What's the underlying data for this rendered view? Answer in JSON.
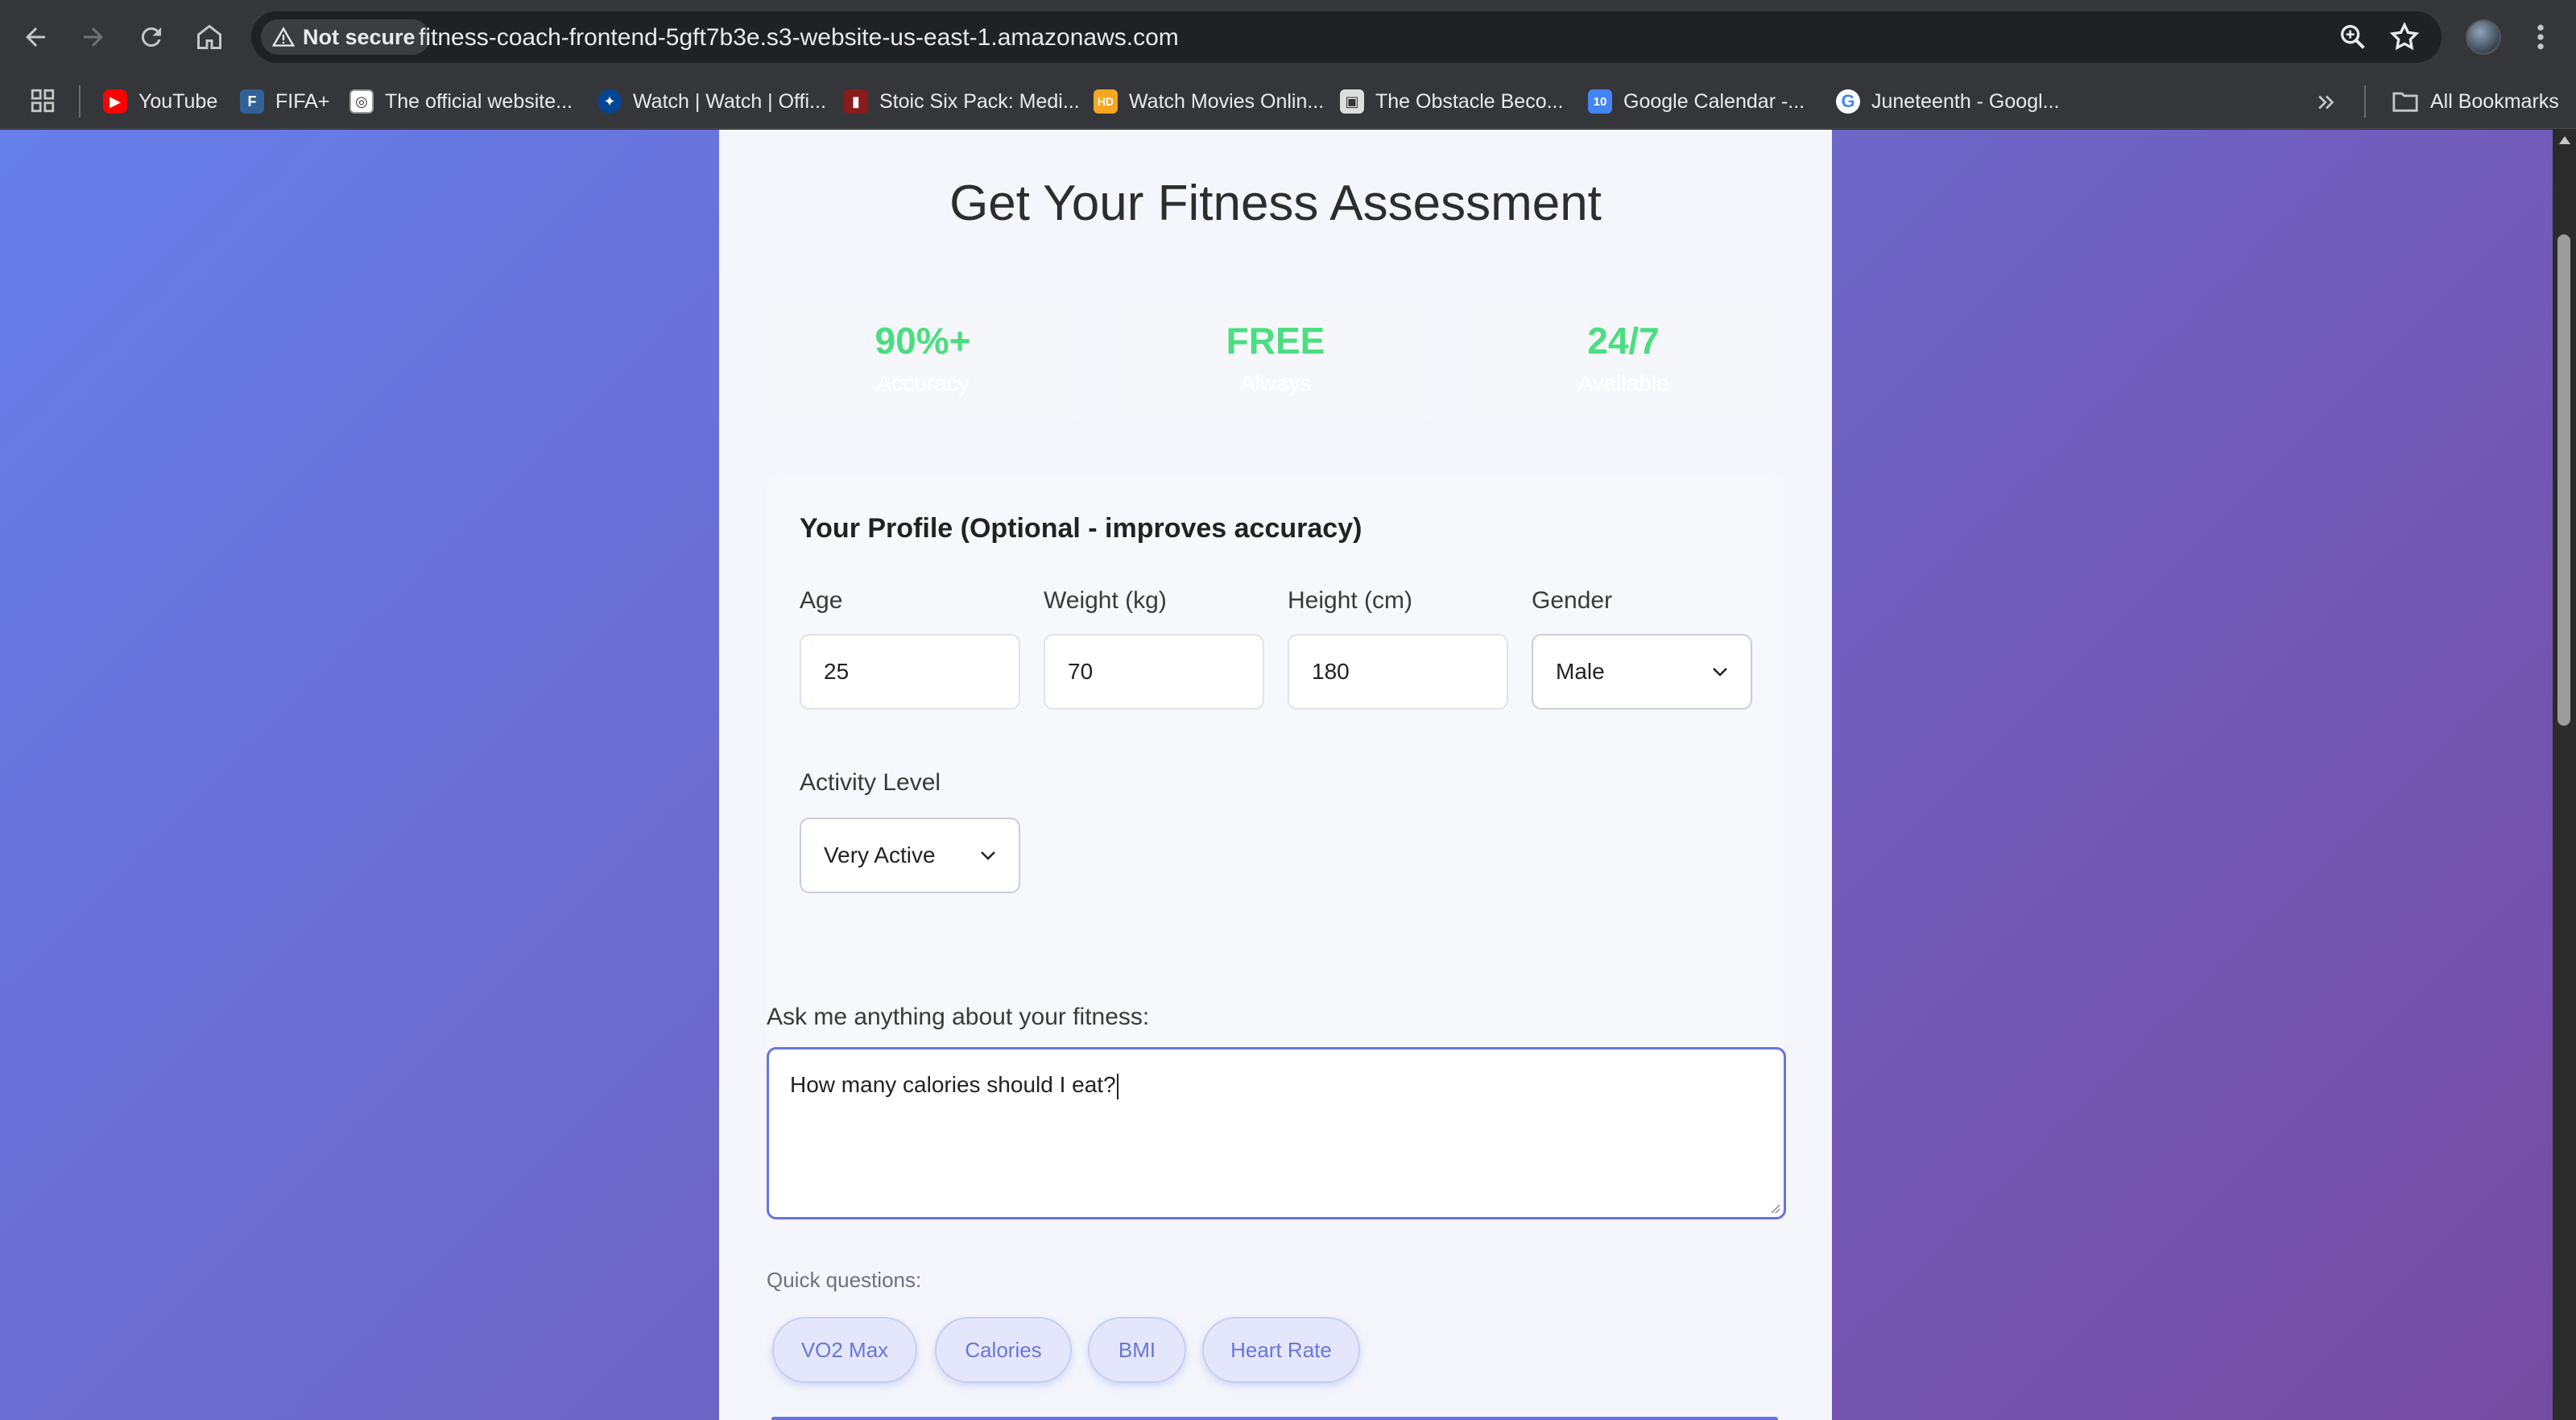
{
  "browser": {
    "security_label": "Not secure",
    "url": "fitness-coach-frontend-5gft7b3e.s3-website-us-east-1.amazonaws.com",
    "bookmarks": [
      {
        "label": "YouTube",
        "icon": "youtube-icon",
        "color": "#ff0000"
      },
      {
        "label": "FIFA+",
        "icon": "fifa-icon",
        "color": "#326295"
      },
      {
        "label": "The official website...",
        "icon": "site-icon",
        "color": "#ffffff"
      },
      {
        "label": "Watch | Watch | Offi...",
        "icon": "chelsea-icon",
        "color": "#034694"
      },
      {
        "label": "Stoic Six Pack: Medi...",
        "icon": "book-icon",
        "color": "#8b1a1a"
      },
      {
        "label": "Watch Movies Onlin...",
        "icon": "hd-icon",
        "color": "#f5a623"
      },
      {
        "label": "The Obstacle Beco...",
        "icon": "book-cover-icon",
        "color": "#dddddd"
      },
      {
        "label": "Google Calendar -...",
        "icon": "calendar-icon",
        "color": "#4285f4"
      },
      {
        "label": "Juneteenth - Googl...",
        "icon": "google-icon",
        "color": "#ffffff"
      }
    ],
    "all_bookmarks_label": "All Bookmarks"
  },
  "page": {
    "title": "Get Your Fitness Assessment",
    "stats": [
      {
        "value": "90%+",
        "label": "Accuracy"
      },
      {
        "value": "FREE",
        "label": "Always"
      },
      {
        "value": "24/7",
        "label": "Available"
      }
    ],
    "profile": {
      "title": "Your Profile (Optional - improves accuracy)",
      "age_label": "Age",
      "age_value": "25",
      "weight_label": "Weight (kg)",
      "weight_value": "70",
      "height_label": "Height (cm)",
      "height_value": "180",
      "gender_label": "Gender",
      "gender_value": "Male",
      "activity_label": "Activity Level",
      "activity_value": "Very Active"
    },
    "ask_label": "Ask me anything about your fitness:",
    "question_text": "How many calories should I eat?",
    "quick_label": "Quick questions:",
    "quick_questions": [
      "VO2 Max",
      "Calories",
      "BMI",
      "Heart Rate"
    ]
  },
  "colors": {
    "accent": "#667eea",
    "gradient_end": "#764ba2",
    "stat_green": "#4ade80"
  }
}
